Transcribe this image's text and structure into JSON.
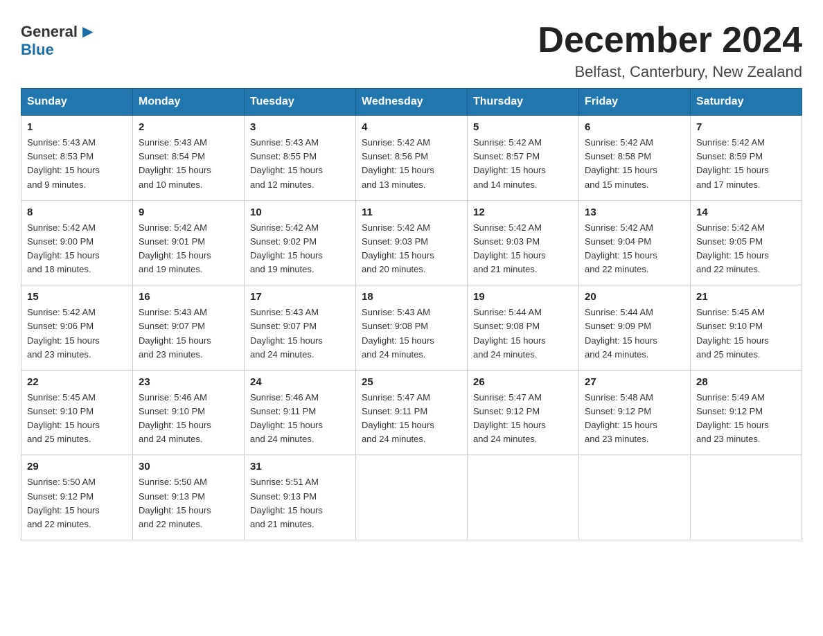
{
  "header": {
    "logo_general": "General",
    "logo_blue": "Blue",
    "month_title": "December 2024",
    "location": "Belfast, Canterbury, New Zealand"
  },
  "weekdays": [
    "Sunday",
    "Monday",
    "Tuesday",
    "Wednesday",
    "Thursday",
    "Friday",
    "Saturday"
  ],
  "weeks": [
    [
      {
        "day": "1",
        "sunrise": "5:43 AM",
        "sunset": "8:53 PM",
        "daylight": "15 hours and 9 minutes."
      },
      {
        "day": "2",
        "sunrise": "5:43 AM",
        "sunset": "8:54 PM",
        "daylight": "15 hours and 10 minutes."
      },
      {
        "day": "3",
        "sunrise": "5:43 AM",
        "sunset": "8:55 PM",
        "daylight": "15 hours and 12 minutes."
      },
      {
        "day": "4",
        "sunrise": "5:42 AM",
        "sunset": "8:56 PM",
        "daylight": "15 hours and 13 minutes."
      },
      {
        "day": "5",
        "sunrise": "5:42 AM",
        "sunset": "8:57 PM",
        "daylight": "15 hours and 14 minutes."
      },
      {
        "day": "6",
        "sunrise": "5:42 AM",
        "sunset": "8:58 PM",
        "daylight": "15 hours and 15 minutes."
      },
      {
        "day": "7",
        "sunrise": "5:42 AM",
        "sunset": "8:59 PM",
        "daylight": "15 hours and 17 minutes."
      }
    ],
    [
      {
        "day": "8",
        "sunrise": "5:42 AM",
        "sunset": "9:00 PM",
        "daylight": "15 hours and 18 minutes."
      },
      {
        "day": "9",
        "sunrise": "5:42 AM",
        "sunset": "9:01 PM",
        "daylight": "15 hours and 19 minutes."
      },
      {
        "day": "10",
        "sunrise": "5:42 AM",
        "sunset": "9:02 PM",
        "daylight": "15 hours and 19 minutes."
      },
      {
        "day": "11",
        "sunrise": "5:42 AM",
        "sunset": "9:03 PM",
        "daylight": "15 hours and 20 minutes."
      },
      {
        "day": "12",
        "sunrise": "5:42 AM",
        "sunset": "9:03 PM",
        "daylight": "15 hours and 21 minutes."
      },
      {
        "day": "13",
        "sunrise": "5:42 AM",
        "sunset": "9:04 PM",
        "daylight": "15 hours and 22 minutes."
      },
      {
        "day": "14",
        "sunrise": "5:42 AM",
        "sunset": "9:05 PM",
        "daylight": "15 hours and 22 minutes."
      }
    ],
    [
      {
        "day": "15",
        "sunrise": "5:42 AM",
        "sunset": "9:06 PM",
        "daylight": "15 hours and 23 minutes."
      },
      {
        "day": "16",
        "sunrise": "5:43 AM",
        "sunset": "9:07 PM",
        "daylight": "15 hours and 23 minutes."
      },
      {
        "day": "17",
        "sunrise": "5:43 AM",
        "sunset": "9:07 PM",
        "daylight": "15 hours and 24 minutes."
      },
      {
        "day": "18",
        "sunrise": "5:43 AM",
        "sunset": "9:08 PM",
        "daylight": "15 hours and 24 minutes."
      },
      {
        "day": "19",
        "sunrise": "5:44 AM",
        "sunset": "9:08 PM",
        "daylight": "15 hours and 24 minutes."
      },
      {
        "day": "20",
        "sunrise": "5:44 AM",
        "sunset": "9:09 PM",
        "daylight": "15 hours and 24 minutes."
      },
      {
        "day": "21",
        "sunrise": "5:45 AM",
        "sunset": "9:10 PM",
        "daylight": "15 hours and 25 minutes."
      }
    ],
    [
      {
        "day": "22",
        "sunrise": "5:45 AM",
        "sunset": "9:10 PM",
        "daylight": "15 hours and 25 minutes."
      },
      {
        "day": "23",
        "sunrise": "5:46 AM",
        "sunset": "9:10 PM",
        "daylight": "15 hours and 24 minutes."
      },
      {
        "day": "24",
        "sunrise": "5:46 AM",
        "sunset": "9:11 PM",
        "daylight": "15 hours and 24 minutes."
      },
      {
        "day": "25",
        "sunrise": "5:47 AM",
        "sunset": "9:11 PM",
        "daylight": "15 hours and 24 minutes."
      },
      {
        "day": "26",
        "sunrise": "5:47 AM",
        "sunset": "9:12 PM",
        "daylight": "15 hours and 24 minutes."
      },
      {
        "day": "27",
        "sunrise": "5:48 AM",
        "sunset": "9:12 PM",
        "daylight": "15 hours and 23 minutes."
      },
      {
        "day": "28",
        "sunrise": "5:49 AM",
        "sunset": "9:12 PM",
        "daylight": "15 hours and 23 minutes."
      }
    ],
    [
      {
        "day": "29",
        "sunrise": "5:50 AM",
        "sunset": "9:12 PM",
        "daylight": "15 hours and 22 minutes."
      },
      {
        "day": "30",
        "sunrise": "5:50 AM",
        "sunset": "9:13 PM",
        "daylight": "15 hours and 22 minutes."
      },
      {
        "day": "31",
        "sunrise": "5:51 AM",
        "sunset": "9:13 PM",
        "daylight": "15 hours and 21 minutes."
      },
      null,
      null,
      null,
      null
    ]
  ],
  "labels": {
    "sunrise": "Sunrise:",
    "sunset": "Sunset:",
    "daylight": "Daylight:"
  }
}
